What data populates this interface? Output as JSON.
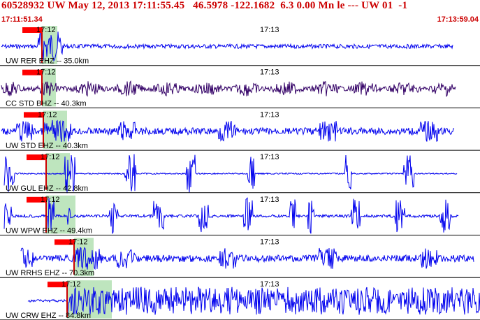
{
  "header": {
    "title": "60528932 UW May 12, 2013 17:11:55.45   46.5978 -122.1682  6.3 0.00 Mn le --- UW 01  -1",
    "start_time": "17:11:51.34",
    "end_time": "17:13:59.04"
  },
  "colors": {
    "header_text": "#cc0000",
    "trace_blue": "#0000ee",
    "trace_purple": "#330066",
    "pick_flag": "#ff0000",
    "pick_window": "#a8dca8",
    "separator": "#000000"
  },
  "time_ticks": [
    "17:12",
    "17:13"
  ],
  "traces": [
    {
      "label": "UW RER EHZ -- 35.0km",
      "tick1": "17:12",
      "tick2": "17:13",
      "color": "#0000ee",
      "style": "quiet"
    },
    {
      "label": "CC STD BHZ -- 40.3km",
      "tick1": "17:12",
      "tick2": "17:13",
      "color": "#330066",
      "style": "wavy"
    },
    {
      "label": "UW STD EHZ -- 40.3km",
      "tick1": "17:12",
      "tick2": "17:13",
      "color": "#0000ee",
      "style": "busy"
    },
    {
      "label": "UW GUL EHZ -- 42.8km",
      "tick1": "17:12",
      "tick2": "17:13",
      "color": "#0000ee",
      "style": "bursts"
    },
    {
      "label": "UW WPW EHZ -- 49.4km",
      "tick1": "17:12",
      "tick2": "17:13",
      "color": "#0000ee",
      "style": "spikes"
    },
    {
      "label": "UW RRHS EHZ -- 70.3km",
      "tick1": "17:12",
      "tick2": "17:13",
      "color": "#0000ee",
      "style": "busy"
    },
    {
      "label": "UW CRW EHZ -- 84.8km",
      "tick1": "17:12",
      "tick2": "17:13",
      "color": "#0000ee",
      "style": "saturated"
    }
  ]
}
